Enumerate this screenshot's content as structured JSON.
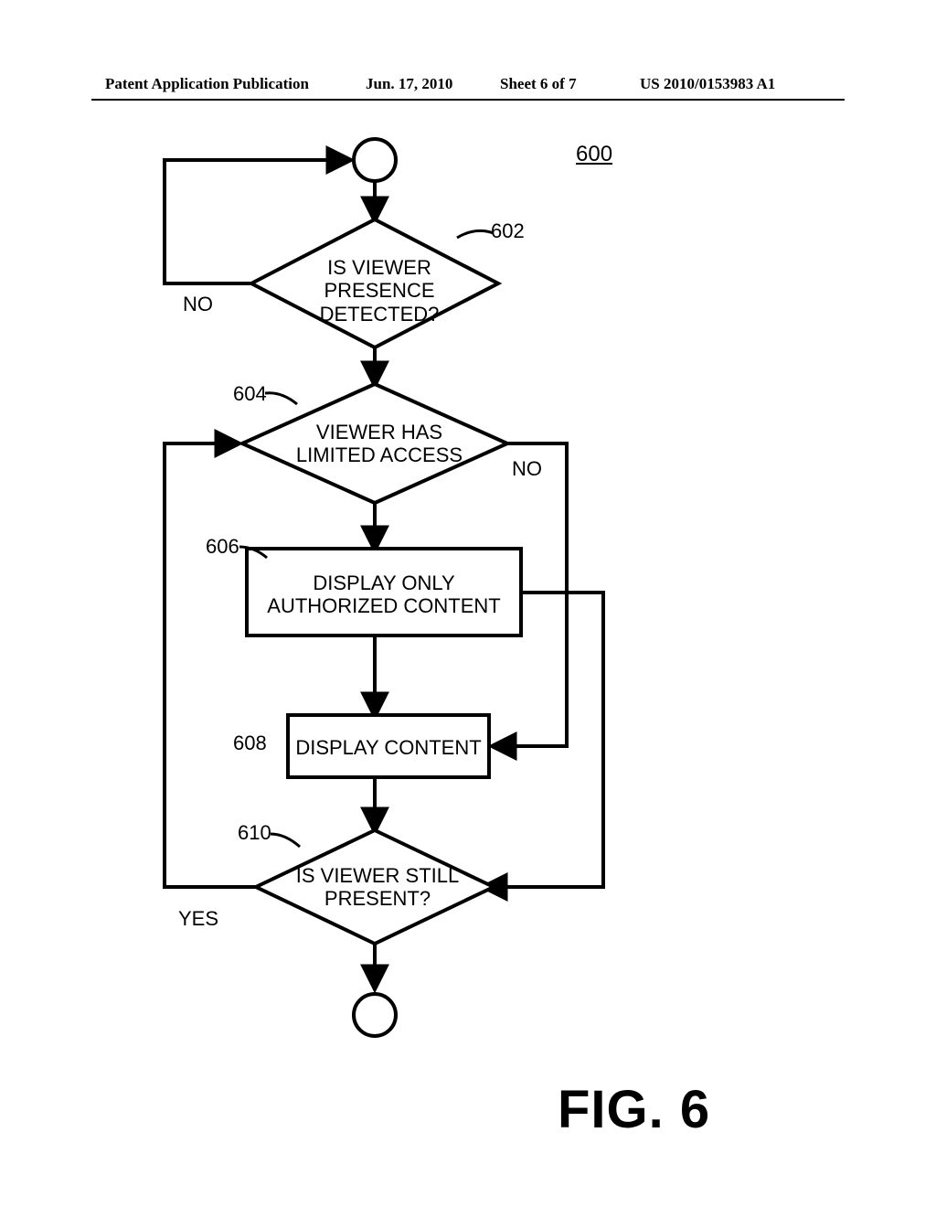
{
  "header": {
    "publication": "Patent Application Publication",
    "date": "Jun. 17, 2010",
    "sheet": "Sheet 6 of 7",
    "number": "US 2010/0153983 A1"
  },
  "figure": {
    "ref": "600",
    "caption": "FIG. 6",
    "nodes": {
      "n602": {
        "ref": "602",
        "text": "IS VIEWER PRESENCE DETECTED?"
      },
      "n604": {
        "ref": "604",
        "text": "VIEWER HAS LIMITED ACCESS"
      },
      "n606": {
        "ref": "606",
        "text": "DISPLAY ONLY AUTHORIZED CONTENT"
      },
      "n608": {
        "ref": "608",
        "text": "DISPLAY CONTENT"
      },
      "n610": {
        "ref": "610",
        "text": "IS VIEWER STILL PRESENT?"
      }
    },
    "labels": {
      "no1": "NO",
      "no2": "NO",
      "yes": "YES"
    }
  }
}
